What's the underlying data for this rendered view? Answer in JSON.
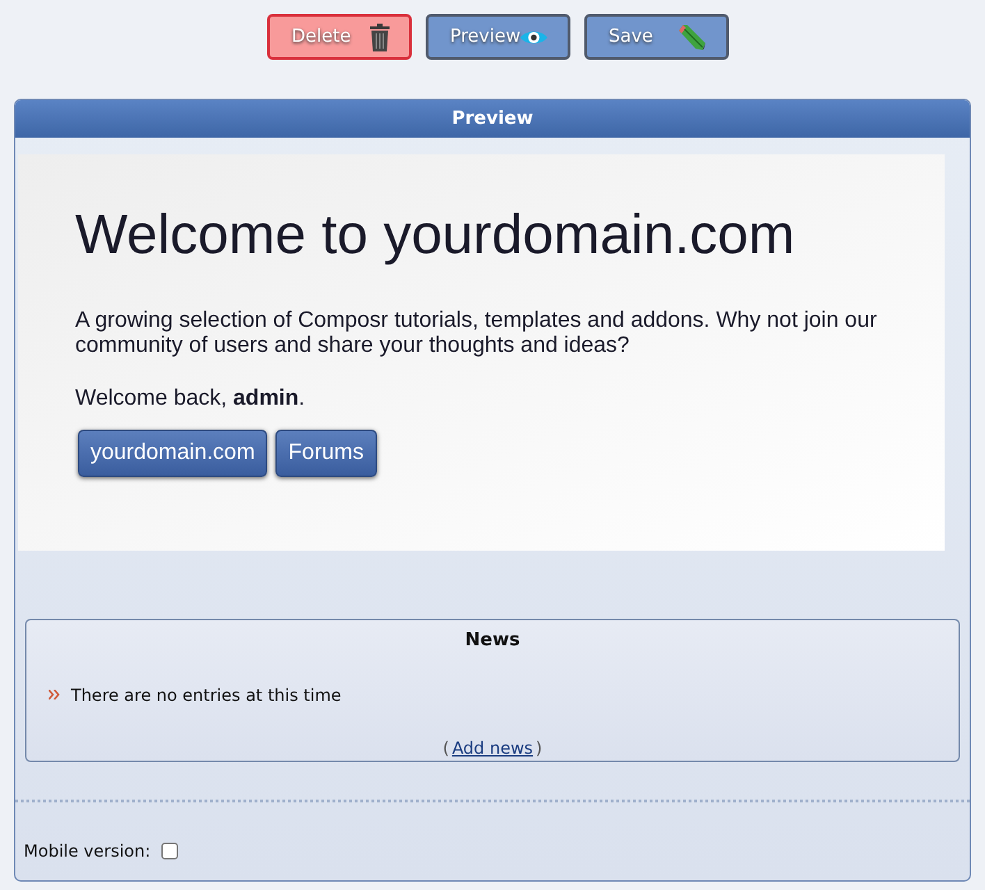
{
  "toolbar": [
    {
      "label": "Delete",
      "kind": "delete"
    },
    {
      "label": "Preview",
      "kind": "preview"
    },
    {
      "label": "Save",
      "kind": "save"
    }
  ],
  "panel": {
    "title": "Preview",
    "welcome": {
      "heading": "Welcome to yourdomain.com",
      "intro": "A growing selection of Composr tutorials, templates and addons. Why not join our community of users and share your thoughts and ideas?",
      "greeting": "Welcome back, **admin**.",
      "buttons": [
        "yourdomain.com",
        "Forums"
      ]
    },
    "news": {
      "title": "News",
      "empty": "There are no entries at this time",
      "open_paren": "(",
      "link": "Add news",
      "close_paren": ")"
    },
    "mobile": {
      "label": "Mobile version:",
      "checked": false
    }
  }
}
